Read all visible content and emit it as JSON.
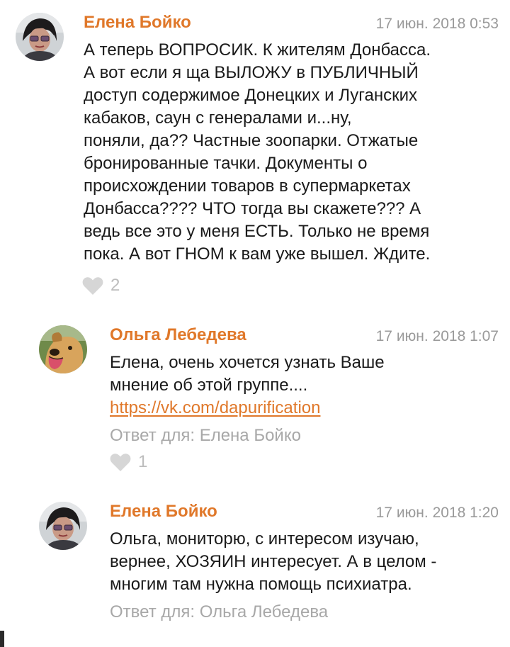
{
  "comments": [
    {
      "author": "Елена Бойко",
      "date": "17 июн. 2018 0:53",
      "lines": [
        "А теперь ВОПРОСИК. К жителям Донбасса.",
        "А вот если я ща ВЫЛОЖУ в ПУБЛИЧНЫЙ",
        "доступ содержимое Донецких и Луганских",
        "кабаков,  саун с генералами и...ну,",
        "поняли, да?? Частные зоопарки. Отжатые",
        "бронированные тачки. Документы о",
        "происхождении товаров в супермаркетах",
        "Донбасса???? ЧТО тогда вы скажете??? А",
        "ведь все это у меня ЕСТЬ. Только не время",
        "пока. А вот ГНОМ к вам уже вышел. Ждите."
      ],
      "likes": "2"
    },
    {
      "author": "Ольга Лебедева",
      "date": "17 июн. 2018 1:07",
      "lines": [
        "Елена, очень хочется узнать Ваше",
        "мнение об этой группе...."
      ],
      "link": "https://vk.com/dapurification",
      "reply_to": "Ответ для: Елена Бойко",
      "likes": "1"
    },
    {
      "author": "Елена Бойко",
      "date": "17 июн. 2018 1:20",
      "lines": [
        "Ольга, мониторю, с интересом изучаю,",
        "вернее, ХОЗЯИН интересует. А в целом -",
        "многим там нужна помощь психиатра."
      ],
      "reply_to": "Ответ для: Ольга Лебедева"
    }
  ],
  "colors": {
    "author": "#e0782a",
    "link": "#e0782a",
    "date": "#9a9a9a",
    "meta": "#a8a8a8",
    "like_icon": "#d6d6d6"
  },
  "icons": {
    "like": "heart-icon"
  }
}
